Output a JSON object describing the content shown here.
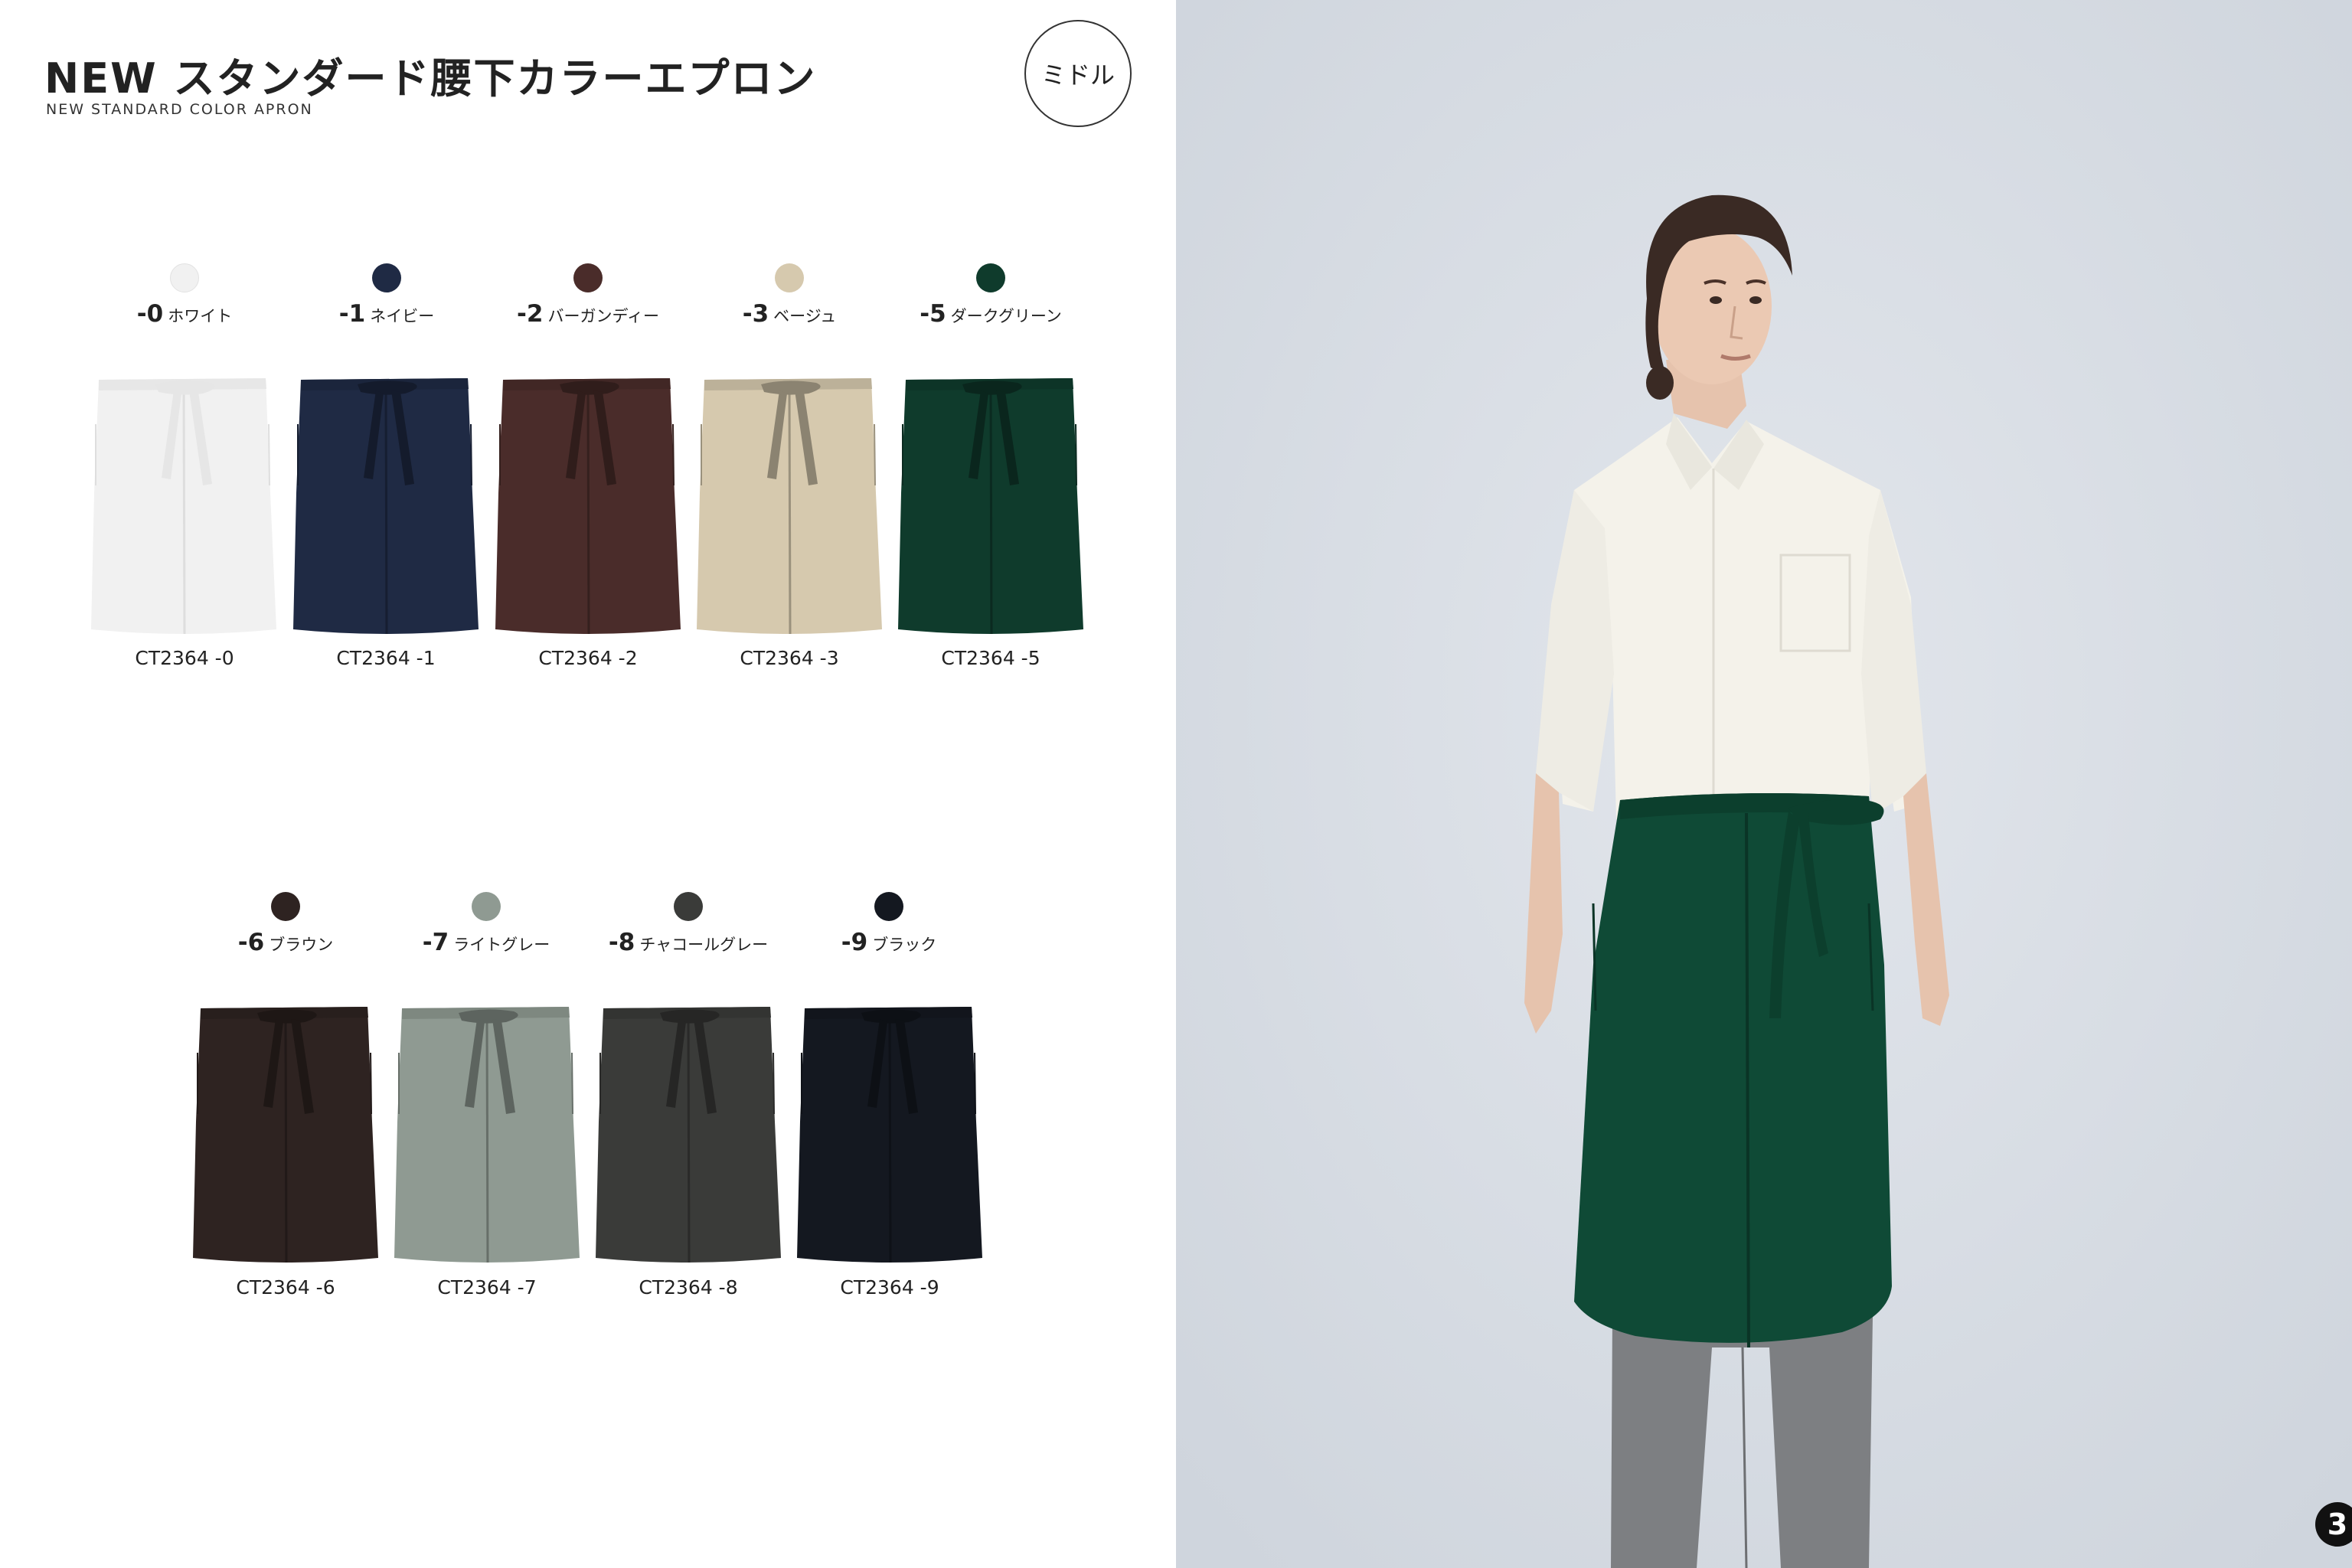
{
  "header": {
    "title": "NEW スタンダード腰下カラーエプロン",
    "subtitle": "NEW STANDARD COLOR APRON",
    "size_badge": "ミドル"
  },
  "colors": [
    {
      "num": "-0",
      "name": "ホワイト",
      "code": "CT2364 -0",
      "hex": "#f1f1f1"
    },
    {
      "num": "-1",
      "name": "ネイビー",
      "code": "CT2364 -1",
      "hex": "#1f2a44"
    },
    {
      "num": "-2",
      "name": "バーガンディー",
      "code": "CT2364 -2",
      "hex": "#4a2c2a"
    },
    {
      "num": "-3",
      "name": "ベージュ",
      "code": "CT2364 -3",
      "hex": "#d6c9ae"
    },
    {
      "num": "-5",
      "name": "ダークグリーン",
      "code": "CT2364 -5",
      "hex": "#0f3b2c"
    },
    {
      "num": "-6",
      "name": "ブラウン",
      "code": "CT2364 -6",
      "hex": "#2e2321"
    },
    {
      "num": "-7",
      "name": "ライトグレー",
      "code": "CT2364 -7",
      "hex": "#8f9a92"
    },
    {
      "num": "-8",
      "name": "チャコールグレー",
      "code": "CT2364 -8",
      "hex": "#3a3b39"
    },
    {
      "num": "-9",
      "name": "ブラック",
      "code": "CT2364 -9",
      "hex": "#141820"
    }
  ],
  "page_number": "3",
  "photo": {
    "apron_color": "#0f4a36",
    "shirt_color": "#f4f2ea",
    "trousers_color": "#7d7f82",
    "background_color": "#d8dde5"
  }
}
